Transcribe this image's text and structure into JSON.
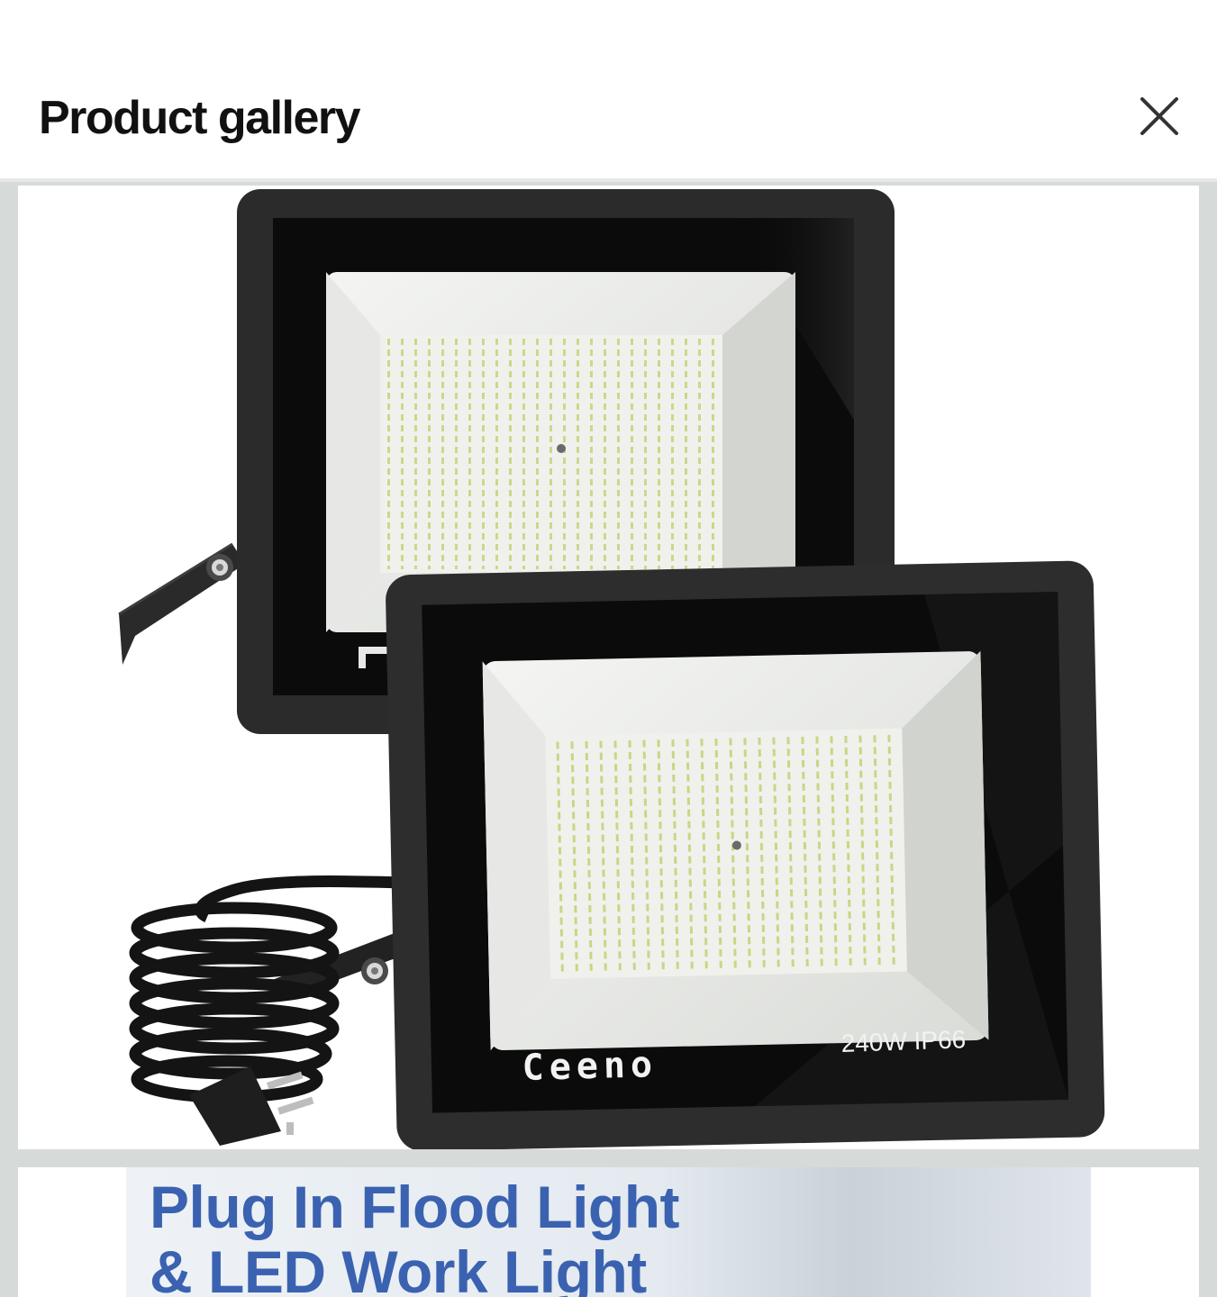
{
  "header": {
    "title": "Product gallery",
    "close_icon": "close-icon"
  },
  "gallery": {
    "images": [
      {
        "name": "floodlight-pair-photo",
        "brand": "Ceeno",
        "spec_text": "240W  IP66"
      },
      {
        "name": "plug-in-flood-light-banner",
        "headline_line1": "Plug In Flood Light",
        "headline_line2": "& LED Work Light"
      }
    ]
  },
  "colors": {
    "background": "#ffffff",
    "gallery_background": "#d6dbd9",
    "fixture_body": "#2b2b2b",
    "banner_text": "#3a62b0"
  }
}
